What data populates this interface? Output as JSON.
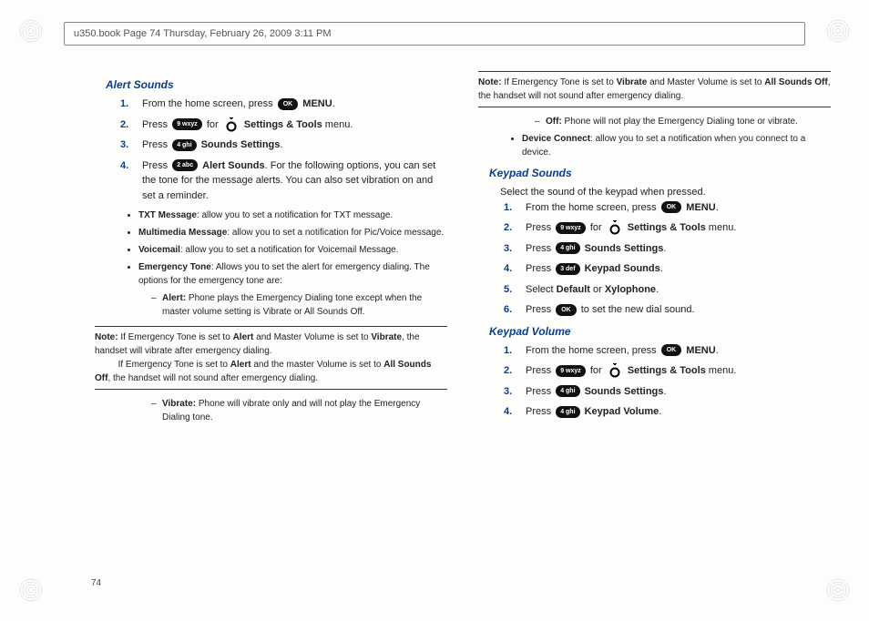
{
  "header": "u350.book  Page 74  Thursday, February 26, 2009  3:11 PM",
  "page_number": "74",
  "keys": {
    "ok": "OK",
    "k9": "9 wxyz",
    "k4": "4 ghi",
    "k2": "2 abc",
    "k3": "3 def"
  },
  "labels": {
    "menu": "MENU",
    "settings_tools": "Settings & Tools",
    "sounds_settings": "Sounds Settings",
    "settings_tools_menu_suffix": " menu.",
    "press": "Press ",
    "for": " for ",
    "from_home": "From the home screen, press ",
    "period": "."
  },
  "left": {
    "title": "Alert Sounds",
    "step4_lead": "Alert Sounds",
    "step4_rest": ". For the following options, you can set the tone for the message alerts. You can also set vibration on and set a reminder.",
    "bullets": [
      {
        "b": "TXT Message",
        "t": ": allow you to set a notification for TXT message."
      },
      {
        "b": "Multimedia Message",
        "t": ": allow you to set a notification for Pic/Voice message."
      },
      {
        "b": "Voicemail",
        "t": ": allow you to set a notification for Voicemail Message."
      },
      {
        "b": "Emergency Tone",
        "t": ": Allows you to set the alert for emergency dialing. The options for the emergency tone are:"
      }
    ],
    "dash_alert": {
      "b": "Alert:",
      "t": " Phone plays the Emergency Dialing tone except when the master volume setting is Vibrate or All Sounds Off."
    },
    "note1": {
      "label": "Note:",
      "l1a": " If Emergency Tone is set to ",
      "l1b": "Alert",
      "l1c": " and Master Volume is set to ",
      "l1d": "Vibrate",
      "l1e": ", the handset will vibrate after emergency dialing.",
      "l2a": "If Emergency Tone is set to ",
      "l2b": "Alert",
      "l2c": " and the master Volume is set to ",
      "l2d": "All Sounds Off",
      "l2e": ", the handset will not sound after emergency dialing."
    },
    "dash_vibrate": {
      "b": "Vibrate:",
      "t": " Phone will vibrate only and will not play the Emergency Dialing tone."
    }
  },
  "right": {
    "note2": {
      "label": "Note:",
      "a": " If Emergency Tone is set to ",
      "b": "Vibrate",
      "c": " and Master Volume is set to ",
      "d": "All Sounds Off",
      "e": ", the handset will not sound after emergency dialing."
    },
    "dash_off": {
      "b": "Off:",
      "t": " Phone will not play the Emergency Dialing tone or vibrate."
    },
    "bullet_device": {
      "b": "Device Connect",
      "t": ": allow you to set a notification when you connect to a device."
    },
    "keypad_sounds": {
      "title": "Keypad Sounds",
      "intro": "Select the sound of the keypad when pressed.",
      "step4": "Keypad Sounds",
      "step5a": "Select ",
      "step5b": "Default",
      "step5c": " or ",
      "step5d": "Xylophone",
      "step6": " to set the new dial sound."
    },
    "keypad_volume": {
      "title": "Keypad Volume",
      "step4": "Keypad Volume"
    }
  }
}
